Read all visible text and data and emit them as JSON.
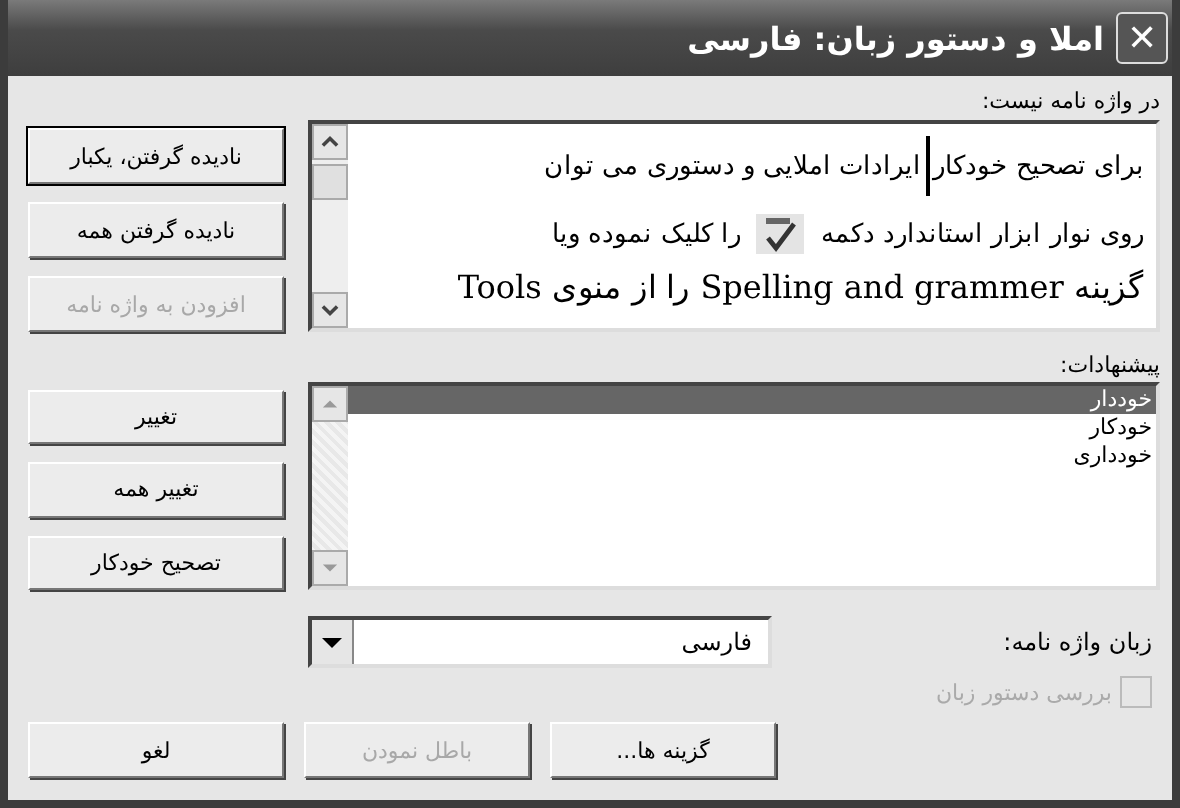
{
  "window": {
    "title": "املا و دستور زبان: فارسی",
    "close": "✕"
  },
  "not_in_dictionary": {
    "label": "در واژه نامه نیست:",
    "lines": [
      {
        "kind": "text",
        "text": "برای تصحیح خودکار",
        "after": "ایرادات املایی و دستوری می توان"
      },
      {
        "kind": "icon",
        "text": "روی نوار ابزار استاندارد دکمه",
        "after": "را کلیک نموده ویا"
      },
      {
        "kind": "cut",
        "text": "گزینه Spelling and grammer را از منوی Tools"
      }
    ]
  },
  "top_buttons": [
    {
      "label": "نادیده گرفتن، یکبار",
      "disabled": false,
      "default": true
    },
    {
      "label": "نادیده گرفتن همه",
      "disabled": false,
      "default": false
    },
    {
      "label": "افزودن به واژه نامه",
      "disabled": true,
      "default": false
    }
  ],
  "suggestions": {
    "label": "پیشنهادات:",
    "items": [
      {
        "text": "خوددار",
        "selected": true
      },
      {
        "text": "خودکار",
        "selected": false
      },
      {
        "text": "خودداری",
        "selected": false
      }
    ]
  },
  "suggestion_buttons": [
    {
      "label": "تغییر",
      "disabled": false
    },
    {
      "label": "تغییر همه",
      "disabled": false
    },
    {
      "label": "تصحیح خودکار",
      "disabled": false
    }
  ],
  "dictionary_language": {
    "label": "زبان واژه نامه:",
    "value": "فارسی"
  },
  "check_grammar": {
    "label": "بررسی دستور زبان",
    "checked": false,
    "disabled": true
  },
  "bottom_buttons": [
    {
      "label": "گزینه ها...",
      "disabled": false
    },
    {
      "label": "باطل نمودن",
      "disabled": true
    },
    {
      "label": "لغو",
      "disabled": false
    }
  ]
}
